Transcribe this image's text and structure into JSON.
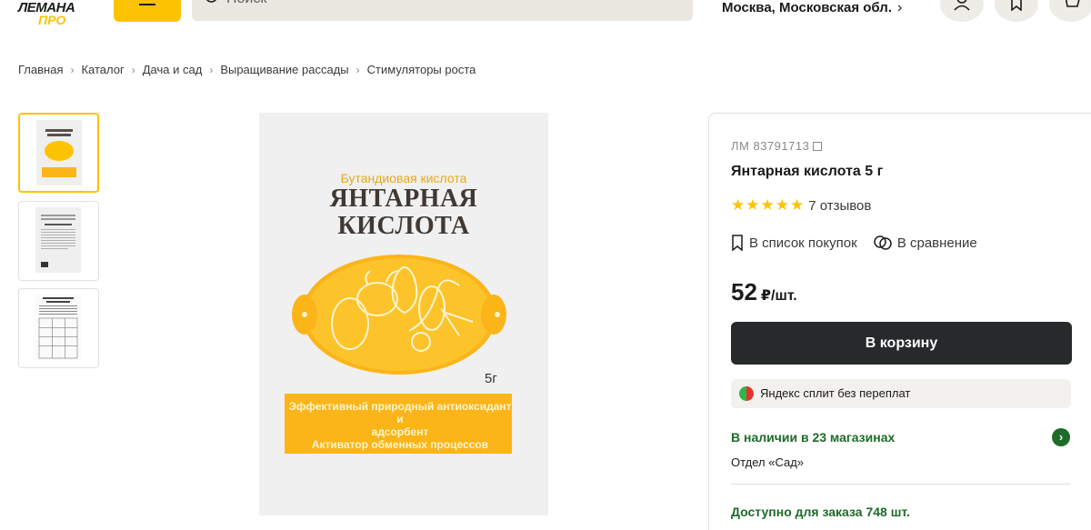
{
  "header": {
    "logo_line1": "ЛЕМАНА",
    "logo_line2": "ПРО",
    "search_placeholder": "Поиск",
    "location": "Москва, Московская обл."
  },
  "breadcrumb": [
    "Главная",
    "Каталог",
    "Дача и сад",
    "Выращивание рассады",
    "Стимуляторы роста"
  ],
  "gallery": {
    "thumbnails": [
      "package-front",
      "package-back",
      "instruction-sheet"
    ],
    "main_image": {
      "subtitle": "Бутандиовая кислота",
      "title_line1": "ЯНТАРНАЯ",
      "title_line2": "КИСЛОТА",
      "weight": "5г",
      "band_line1": "Эффективный природный антиоксидант и",
      "band_line2": "адсорбент",
      "band_line3": "Активатор  обменных  процессов"
    }
  },
  "product": {
    "sku": "ЛМ  83791713",
    "title": "Янтарная кислота 5 г",
    "stars": "★★★★★",
    "rating_value": 5,
    "reviews": "7 отзывов",
    "shopping_list": "В список покупок",
    "compare": "В сравнение",
    "price": "52",
    "price_unit": "₽/шт.",
    "cart_button": "В корзину",
    "split": "Яндекс сплит без переплат",
    "stock": "В наличии в 23 магазинах",
    "department": "Отдел «Сад»",
    "order_available": "Доступно для заказа 748 шт."
  },
  "colors": {
    "brand_yellow": "#fdc300",
    "dark_button": "#262a2b",
    "stock_green": "#1e6b2a"
  }
}
